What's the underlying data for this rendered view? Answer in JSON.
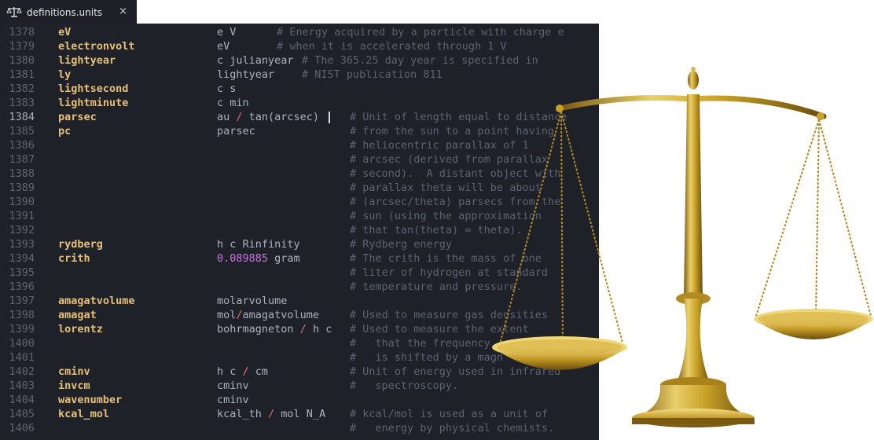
{
  "tab": {
    "title": "definitions.units",
    "icon": "scales-icon",
    "close": "×"
  },
  "editor": {
    "active_line": "1384",
    "lines": [
      {
        "ln": "1378",
        "name": "eV",
        "def": "e V",
        "comment": "# Energy acquired by a particle with charge e"
      },
      {
        "ln": "1379",
        "name": "electronvolt",
        "def": "eV",
        "comment": "# when it is accelerated through 1 V"
      },
      {
        "ln": "1380",
        "name": "lightyear",
        "def": "c julianyear",
        "comment": "# The 365.25 day year is specified in"
      },
      {
        "ln": "1381",
        "name": "ly",
        "def": "lightyear",
        "comment": "# NIST publication 811"
      },
      {
        "ln": "1382",
        "name": "lightsecond",
        "def": "c s",
        "comment": ""
      },
      {
        "ln": "1383",
        "name": "lightminute",
        "def": "c min",
        "comment": ""
      },
      {
        "ln": "1384",
        "name": "parsec",
        "def": "",
        "comment": "# Unit of length equal to distance"
      },
      {
        "ln": "1385",
        "name": "pc",
        "def": "parsec",
        "comment": "# from the sun to a point having"
      },
      {
        "ln": "1386",
        "name": "",
        "def": "",
        "comment": "# heliocentric parallax of 1"
      },
      {
        "ln": "1387",
        "name": "",
        "def": "",
        "comment": "# arcsec (derived from parallax"
      },
      {
        "ln": "1388",
        "name": "",
        "def": "",
        "comment": "# second).  A distant object with"
      },
      {
        "ln": "1389",
        "name": "",
        "def": "",
        "comment": "# parallax theta will be about"
      },
      {
        "ln": "1390",
        "name": "",
        "def": "",
        "comment": "# (arcsec/theta) parsecs from the"
      },
      {
        "ln": "1391",
        "name": "",
        "def": "",
        "comment": "# sun (using the approximation"
      },
      {
        "ln": "1392",
        "name": "",
        "def": "",
        "comment": "# that tan(theta) = theta)."
      },
      {
        "ln": "1393",
        "name": "rydberg",
        "def": "h c Rinfinity",
        "comment": "# Rydberg energy"
      },
      {
        "ln": "1394",
        "name": "crith",
        "def": "",
        "comment": "# The crith is the mass of one"
      },
      {
        "ln": "1395",
        "name": "",
        "def": "",
        "comment": "# liter of hydrogen at standard"
      },
      {
        "ln": "1396",
        "name": "",
        "def": "",
        "comment": "# temperature and pressure."
      },
      {
        "ln": "1397",
        "name": "amagatvolume",
        "def": "molarvolume",
        "comment": ""
      },
      {
        "ln": "1398",
        "name": "amagat",
        "def": "",
        "comment": "# Used to measure gas densities"
      },
      {
        "ln": "1399",
        "name": "lorentz",
        "def": "",
        "comment": "# Used to measure the extent"
      },
      {
        "ln": "1400",
        "name": "",
        "def": "",
        "comment": "#   that the frequency"
      },
      {
        "ln": "1401",
        "name": "",
        "def": "",
        "comment": "#   is shifted by a magn"
      },
      {
        "ln": "1402",
        "name": "cminv",
        "def": "",
        "comment": "# Unit of energy used in infrared"
      },
      {
        "ln": "1403",
        "name": "invcm",
        "def": "cminv",
        "comment": "#   spectroscopy."
      },
      {
        "ln": "1404",
        "name": "wavenumber",
        "def": "cminv",
        "comment": ""
      },
      {
        "ln": "1405",
        "name": "kcal_mol",
        "def": "",
        "comment": "# kcal/mol is used as a unit of"
      },
      {
        "ln": "1406",
        "name": "",
        "def": "",
        "comment": "#   energy by physical chemists."
      }
    ],
    "parsec_def": [
      "au ",
      "/",
      " tan(arcsec)"
    ],
    "crith_def": [
      "0.089885",
      " gram"
    ],
    "amagat_def": [
      "mol",
      "/",
      "amagatvolume"
    ],
    "lorentz_def": [
      "bohrmagneton ",
      "/",
      " h c"
    ],
    "cminv_def": [
      "h c ",
      "/",
      " cm"
    ],
    "kcal_def": [
      "kcal_th ",
      "/",
      " mol N_A"
    ]
  },
  "overlay": {
    "icon": "balance-scale-icon"
  },
  "colors": {
    "editor_bg": "#1e2127",
    "name": "#e5c07b",
    "comment": "#5c6370",
    "operator": "#e06c75",
    "number": "#c678dd",
    "brass": "#c9a227"
  }
}
